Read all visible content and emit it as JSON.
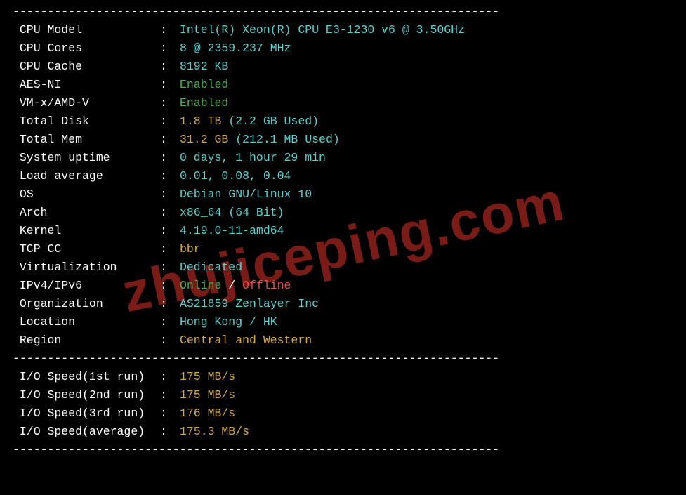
{
  "divider": "----------------------------------------------------------------------",
  "watermark": "zhujiceping.com",
  "rows": [
    {
      "label": "CPU Model",
      "segments": [
        {
          "text": "Intel(R) Xeon(R) CPU E3-1230 v6 @ 3.50GHz",
          "cls": "cyan"
        }
      ]
    },
    {
      "label": "CPU Cores",
      "segments": [
        {
          "text": "8 @ 2359.237 MHz",
          "cls": "cyan"
        }
      ]
    },
    {
      "label": "CPU Cache",
      "segments": [
        {
          "text": "8192 KB",
          "cls": "cyan"
        }
      ]
    },
    {
      "label": "AES-NI",
      "segments": [
        {
          "text": "Enabled",
          "cls": "green"
        }
      ]
    },
    {
      "label": "VM-x/AMD-V",
      "segments": [
        {
          "text": "Enabled",
          "cls": "green"
        }
      ]
    },
    {
      "label": "Total Disk",
      "segments": [
        {
          "text": "1.8 TB ",
          "cls": "yellow"
        },
        {
          "text": "(2.2 GB Used)",
          "cls": "cyan"
        }
      ]
    },
    {
      "label": "Total Mem",
      "segments": [
        {
          "text": "31.2 GB ",
          "cls": "yellow"
        },
        {
          "text": "(212.1 MB Used)",
          "cls": "cyan"
        }
      ]
    },
    {
      "label": "System uptime",
      "segments": [
        {
          "text": "0 days, 1 hour 29 min",
          "cls": "cyan"
        }
      ]
    },
    {
      "label": "Load average",
      "segments": [
        {
          "text": "0.01, 0.08, 0.04",
          "cls": "cyan"
        }
      ]
    },
    {
      "label": "OS",
      "segments": [
        {
          "text": "Debian GNU/Linux 10",
          "cls": "cyan"
        }
      ]
    },
    {
      "label": "Arch",
      "segments": [
        {
          "text": "x86_64 (64 Bit)",
          "cls": "cyan"
        }
      ]
    },
    {
      "label": "Kernel",
      "segments": [
        {
          "text": "4.19.0-11-amd64",
          "cls": "cyan"
        }
      ]
    },
    {
      "label": "TCP CC",
      "segments": [
        {
          "text": "bbr",
          "cls": "yellow"
        }
      ]
    },
    {
      "label": "Virtualization",
      "segments": [
        {
          "text": "Dedicated",
          "cls": "cyan"
        }
      ]
    },
    {
      "label": "IPv4/IPv6",
      "segments": [
        {
          "text": "Online",
          "cls": "green"
        },
        {
          "text": " / ",
          "cls": "white"
        },
        {
          "text": "Offline",
          "cls": "red"
        }
      ]
    },
    {
      "label": "Organization",
      "segments": [
        {
          "text": "AS21859 Zenlayer Inc",
          "cls": "cyan"
        }
      ]
    },
    {
      "label": "Location",
      "segments": [
        {
          "text": "Hong Kong / HK",
          "cls": "cyan"
        }
      ]
    },
    {
      "label": "Region",
      "segments": [
        {
          "text": "Central and Western",
          "cls": "yellow"
        }
      ]
    }
  ],
  "io_rows": [
    {
      "label": "I/O Speed(1st run)",
      "segments": [
        {
          "text": "175 MB/s",
          "cls": "yellow"
        }
      ]
    },
    {
      "label": "I/O Speed(2nd run)",
      "segments": [
        {
          "text": "175 MB/s",
          "cls": "yellow"
        }
      ]
    },
    {
      "label": "I/O Speed(3rd run)",
      "segments": [
        {
          "text": "176 MB/s",
          "cls": "yellow"
        }
      ]
    },
    {
      "label": "I/O Speed(average)",
      "segments": [
        {
          "text": "175.3 MB/s",
          "cls": "yellow"
        }
      ]
    }
  ]
}
